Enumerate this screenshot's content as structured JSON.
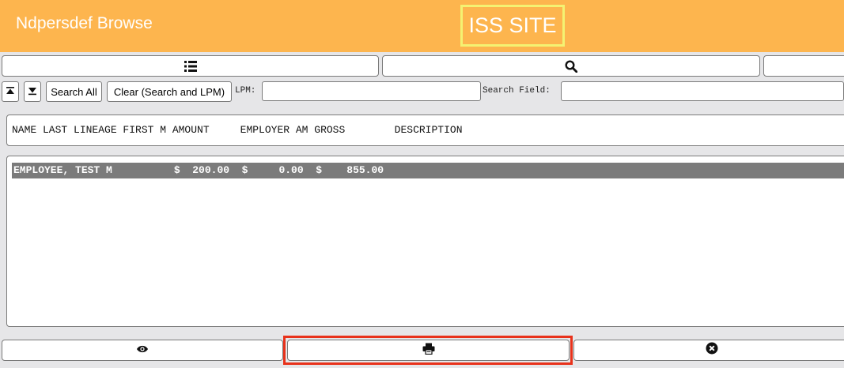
{
  "header": {
    "title": "Ndpersdef Browse",
    "site_label": "ISS SITE",
    "background": "#fdb54e",
    "badge_border": "#f4f272"
  },
  "toolbar_top": [
    {
      "icon": "list-icon"
    },
    {
      "icon": "search-icon"
    },
    {
      "icon": ""
    }
  ],
  "search_bar": {
    "search_all_label": "Search All",
    "clear_label": "Clear (Search and LPM)",
    "lpm_label": "LPM:",
    "lpm_value": "",
    "search_field_label": "Search Field:",
    "search_field_value": ""
  },
  "table": {
    "columns_line": "NAME LAST LINEAGE FIRST M AMOUNT     EMPLOYER AM GROSS        DESCRIPTION",
    "rows": [
      {
        "text": "EMPLOYEE, TEST M          $  200.00  $     0.00  $    855.00",
        "selected": true
      }
    ]
  },
  "toolbar_bottom": [
    {
      "icon": "eye-icon"
    },
    {
      "icon": "print-icon"
    },
    {
      "icon": "close-circle-icon"
    }
  ],
  "colors": {
    "selected_row": "#7b7b7b",
    "highlight": "#e8321b"
  }
}
